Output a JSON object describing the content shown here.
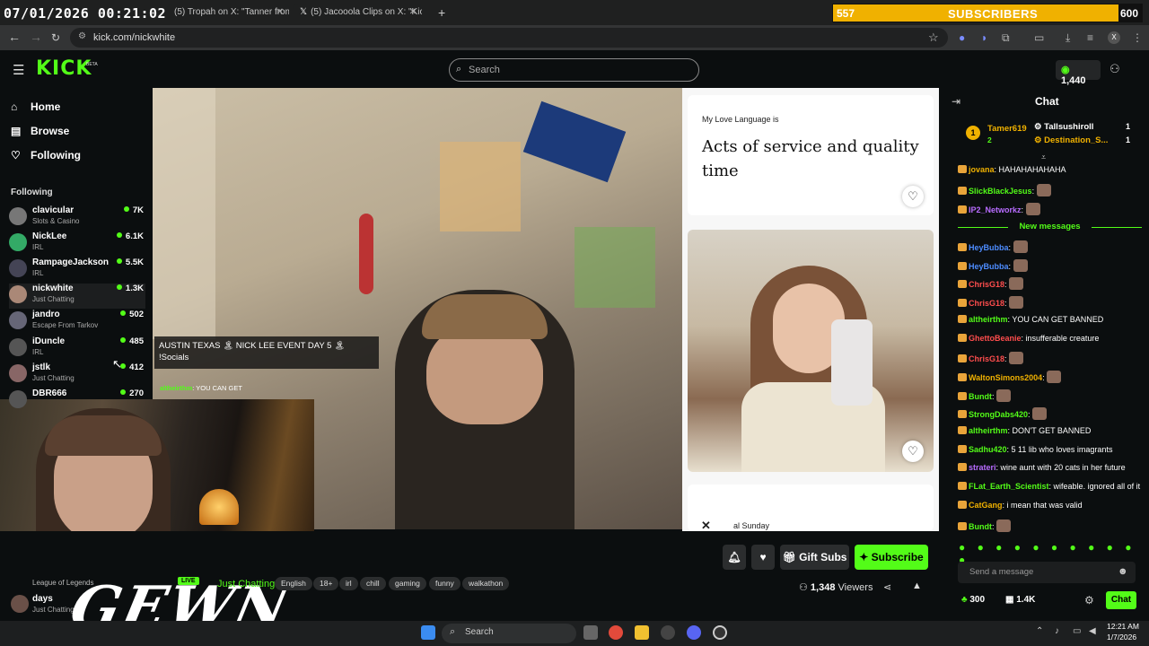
{
  "overlay_timestamp": "07/01/2026 00:21:02",
  "sub_goal": {
    "count": "557",
    "label": "SUBSCRIBERS",
    "goal": "600"
  },
  "browser": {
    "tabs": [
      {
        "title": "(5) Tropah on X: \"Tanner from th"
      },
      {
        "title": "(5) Jacooola Clips on X: \"Kick st"
      }
    ],
    "url": "kick.com/nickwhite"
  },
  "kick": {
    "logo": "KICK",
    "beta": "BETA",
    "search_placeholder": "Search",
    "kicks": "1,440"
  },
  "sidebar": {
    "nav": [
      {
        "label": "Home",
        "icon": "home-icon",
        "glyph": "⌂"
      },
      {
        "label": "Browse",
        "icon": "browse-icon",
        "glyph": "▤"
      },
      {
        "label": "Following",
        "icon": "heart-icon",
        "glyph": "♡"
      }
    ],
    "following_header": "Following",
    "following": [
      {
        "name": "clavicular",
        "category": "Slots & Casino",
        "viewers": "7K"
      },
      {
        "name": "NickLee",
        "category": "IRL",
        "viewers": "6.1K"
      },
      {
        "name": "RampageJackson",
        "category": "IRL",
        "viewers": "5.5K"
      },
      {
        "name": "nickwhite",
        "category": "Just Chatting",
        "viewers": "1.3K"
      },
      {
        "name": "jandro",
        "category": "Escape From Tarkov",
        "viewers": "502"
      },
      {
        "name": "iDuncle",
        "category": "IRL",
        "viewers": "485"
      },
      {
        "name": "jstlk",
        "category": "Just Chatting",
        "viewers": "412"
      },
      {
        "name": "DBR666",
        "category": "",
        "viewers": "270"
      }
    ],
    "bottom": {
      "recommended_cat": "League of Legends",
      "name": "days",
      "category": "Just Chatting"
    }
  },
  "stream": {
    "overlay_banner": "AUSTIN TEXAS 🏝 NICK LEE EVENT DAY 5 🏝 !Socials",
    "overlay_chat_user": "altheirthm",
    "overlay_chat_msg": ": YOU CAN GET",
    "watermark": "GEWN",
    "live": "LIVE",
    "category": "Just Chatting",
    "tags": [
      "English",
      "18+",
      "irl",
      "chill",
      "gaming",
      "funny",
      "walkathon"
    ],
    "viewers": "1,348",
    "viewers_label": "Viewers",
    "gift_subs": "Gift Subs",
    "subscribe": "Subscribe"
  },
  "dating_app": {
    "prompt_label": "My Love Language is",
    "prompt_answer": "Acts of service and quality time",
    "bottom_text": "al Sunday"
  },
  "chat": {
    "title": "Chat",
    "leaderboard": [
      {
        "rank": "1",
        "name": "Tamer619",
        "count": "2"
      },
      {
        "name": "Tallsushiroll",
        "count": "1"
      },
      {
        "name": "Destination_S...",
        "count": "1"
      }
    ],
    "new_messages": "New messages",
    "messages_before": [
      {
        "user": "jovana",
        "color": "#f0b100",
        "text": "HAHAHAHAHAHA"
      },
      {
        "user": "SlickBlackJesus",
        "color": "#53fc18",
        "text": ""
      },
      {
        "user": "IP2_Networkz",
        "color": "#b86cff",
        "text": ""
      }
    ],
    "messages_after": [
      {
        "user": "HeyBubba",
        "color": "#4d8cff",
        "text": ""
      },
      {
        "user": "HeyBubba",
        "color": "#4d8cff",
        "text": ""
      },
      {
        "user": "ChrisG18",
        "color": "#ff4d4d",
        "text": ""
      },
      {
        "user": "ChrisG18",
        "color": "#ff4d4d",
        "text": ""
      },
      {
        "user": "altheirthm",
        "color": "#53fc18",
        "text": "YOU CAN GET BANNED"
      },
      {
        "user": "GhettoBeanie",
        "color": "#ff4d4d",
        "text": "insufferable creature"
      },
      {
        "user": "ChrisG18",
        "color": "#ff4d4d",
        "text": ""
      },
      {
        "user": "WaltonSimons2004",
        "color": "#f0b100",
        "text": ""
      },
      {
        "user": "Bundt",
        "color": "#53fc18",
        "text": ""
      },
      {
        "user": "StrongDabs420",
        "color": "#53fc18",
        "text": ""
      },
      {
        "user": "altheirthm",
        "color": "#53fc18",
        "text": "DON'T GET BANNED"
      },
      {
        "user": "Sadhu420",
        "color": "#53fc18",
        "text": "5 11 lib who loves imagrants"
      },
      {
        "user": "strateri",
        "color": "#b86cff",
        "text": "wine aunt with 20 cats in her future"
      },
      {
        "user": "FLat_Earth_Scientist",
        "color": "#53fc18",
        "text": "wifeable. ignored all of it"
      },
      {
        "user": "CatGang",
        "color": "#f0b100",
        "text": "i mean that was valid"
      },
      {
        "user": "Bundt",
        "color": "#53fc18",
        "text": ""
      }
    ],
    "input_placeholder": "Send a message",
    "points": "300",
    "kicks_points": "1.4K",
    "send_label": "Chat"
  },
  "taskbar": {
    "search": "Search",
    "time": "12:21 AM",
    "date": "1/7/2026"
  }
}
